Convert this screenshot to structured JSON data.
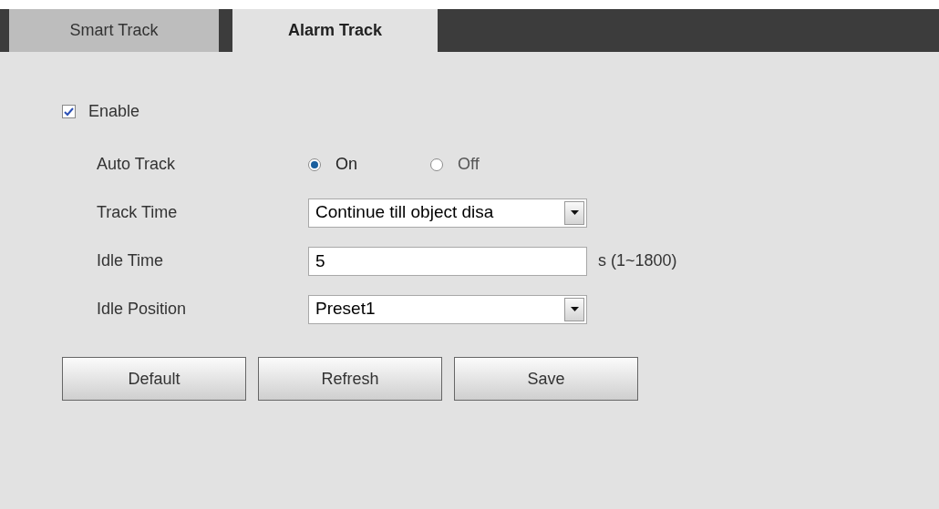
{
  "tabs": [
    {
      "label": "Smart Track",
      "selected": false
    },
    {
      "label": "Alarm Track",
      "selected": true
    }
  ],
  "enable": {
    "label": "Enable",
    "checked": true
  },
  "rows": [
    {
      "kind": "radio",
      "label": "Auto Track",
      "options": [
        {
          "label": "On",
          "selected": true
        },
        {
          "label": "Off",
          "selected": false
        }
      ]
    },
    {
      "kind": "select",
      "label": "Track Time",
      "value": "Continue till object disa"
    },
    {
      "kind": "input",
      "label": "Idle Time",
      "value": "5",
      "hint": "s (1~1800)"
    },
    {
      "kind": "select",
      "label": "Idle Position",
      "value": "Preset1"
    }
  ],
  "buttons": [
    "Default",
    "Refresh",
    "Save"
  ]
}
